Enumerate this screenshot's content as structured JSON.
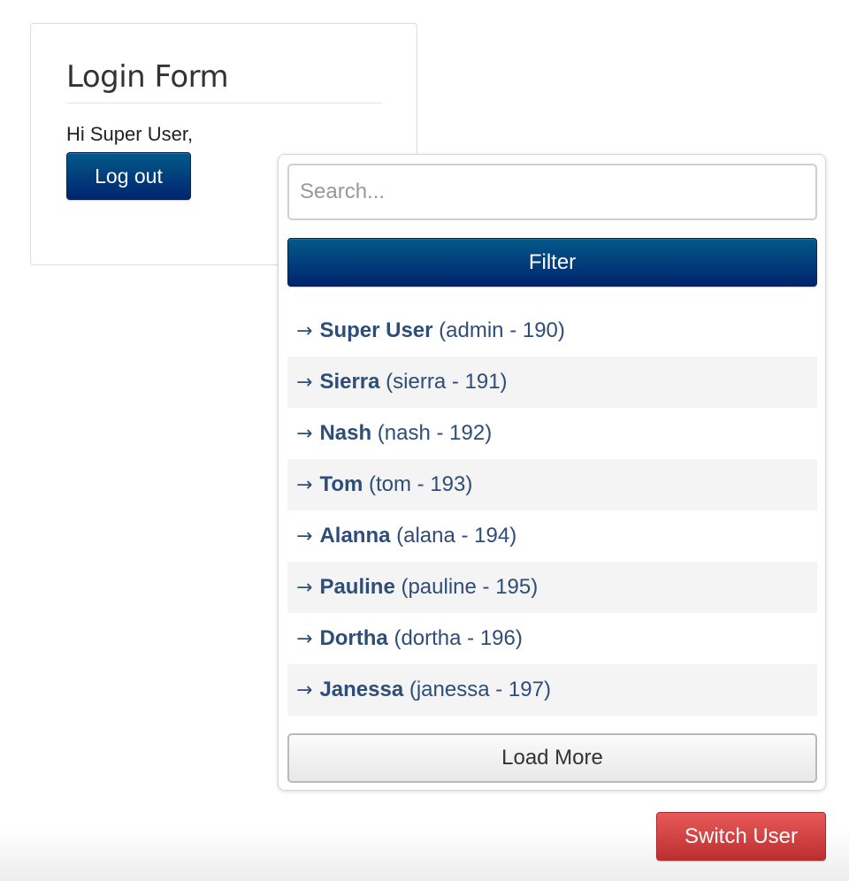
{
  "login": {
    "title": "Login Form",
    "greeting": "Hi Super User,",
    "logout_label": "Log out"
  },
  "switcher": {
    "search_placeholder": "Search...",
    "search_value": "",
    "filter_label": "Filter",
    "arrow_icon": "→",
    "users": [
      {
        "name": "Super User",
        "detail": "(admin - 190)"
      },
      {
        "name": "Sierra",
        "detail": "(sierra - 191)"
      },
      {
        "name": "Nash",
        "detail": "(nash - 192)"
      },
      {
        "name": "Tom",
        "detail": "(tom - 193)"
      },
      {
        "name": "Alanna",
        "detail": "(alana - 194)"
      },
      {
        "name": "Pauline",
        "detail": "(pauline - 195)"
      },
      {
        "name": "Dortha",
        "detail": "(dortha - 196)"
      },
      {
        "name": "Janessa",
        "detail": "(janessa - 197)"
      }
    ],
    "load_more_label": "Load More"
  },
  "switch_user_label": "Switch User",
  "colors": {
    "primary": "#003d7c",
    "danger": "#d13f3f",
    "link": "#2e4d78"
  }
}
